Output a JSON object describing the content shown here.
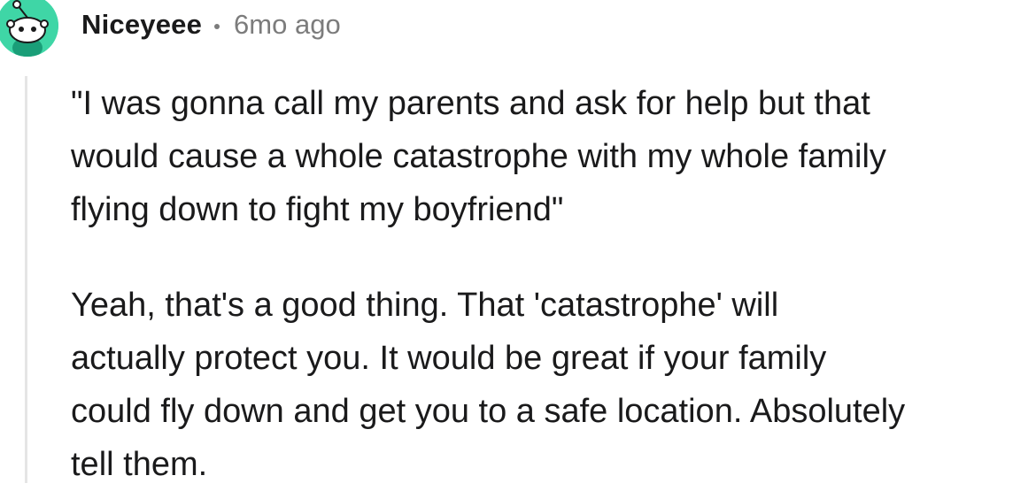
{
  "comment": {
    "author": "Niceyeee",
    "separator": "•",
    "timestamp": "6mo ago",
    "avatar_icon": "snoo-avatar-icon",
    "avatar_color": "#3fd6a6",
    "paragraphs": [
      "\"I was gonna call my parents and ask for help but that\nwould cause a whole catastrophe with my whole family\nflying down to fight my boyfriend\"",
      "Yeah, that's a good thing. That 'catastrophe' will\nactually protect you. It would be great if your family\ncould fly down and get you to a safe location. Absolutely\ntell them."
    ]
  }
}
